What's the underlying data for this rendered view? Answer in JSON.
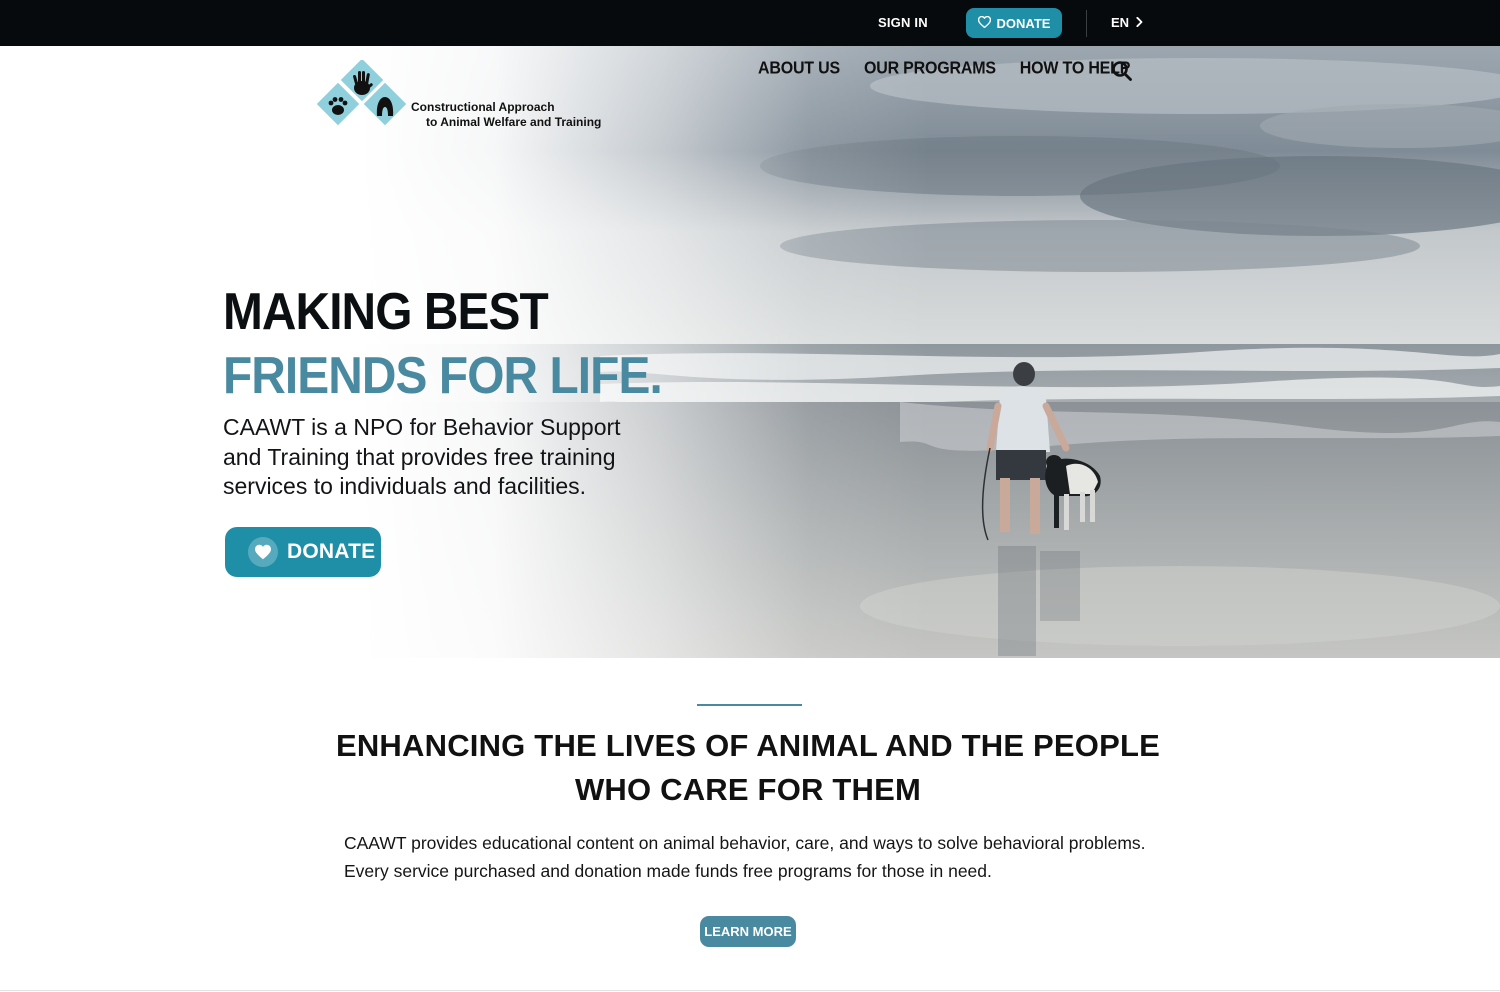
{
  "topbar": {
    "signin_label": "SIGN IN",
    "donate_label": "DONATE",
    "lang_label": "EN"
  },
  "logo": {
    "line1": "Constructional Approach",
    "line2": "to Animal Welfare and Training"
  },
  "nav": {
    "items": [
      {
        "label": "ABOUT US"
      },
      {
        "label": "OUR PROGRAMS"
      },
      {
        "label": "HOW TO HELP"
      }
    ]
  },
  "hero": {
    "headline_line1": "MAKING BEST",
    "headline_line2": "FRIENDS FOR LIFE.",
    "lede": "CAAWT is a NPO for Behavior Support and Training that provides free training services to individuals and facilities.",
    "donate_label": "DONATE"
  },
  "mission": {
    "title_line1": "ENHANCING THE LIVES OF ANIMAL AND THE PEOPLE",
    "title_line2": "WHO CARE FOR THEM",
    "body_line1": "CAAWT provides educational content on animal behavior, care, and ways to solve behavioral problems.",
    "body_line2": "Every service purchased and donation made funds free programs for those in need.",
    "learn_more_label": "LEARN MORE"
  },
  "colors": {
    "accent": "#1f8ea7",
    "headline_blue": "#4a8aa1",
    "topbar_bg": "#070a0c",
    "logo_diamond": "#8fd0dc"
  }
}
